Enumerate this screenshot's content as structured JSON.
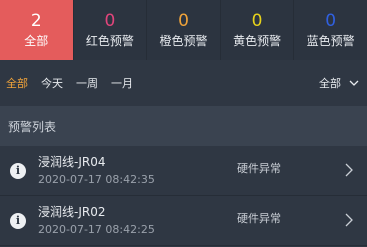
{
  "tabs": [
    {
      "count": "2",
      "label": "全部",
      "color": "#ffffff",
      "active": true
    },
    {
      "count": "0",
      "label": "红色预警",
      "color": "#e0457b",
      "active": false
    },
    {
      "count": "0",
      "label": "橙色预警",
      "color": "#f0a33a",
      "active": false
    },
    {
      "count": "0",
      "label": "黄色预警",
      "color": "#e7d21b",
      "active": false
    },
    {
      "count": "0",
      "label": "蓝色预警",
      "color": "#3060e0",
      "active": false
    }
  ],
  "filters": {
    "items": [
      "全部",
      "今天",
      "一周",
      "一月"
    ],
    "active_index": 0,
    "dropdown_label": "全部",
    "dropdown_icon": "chevron-down-icon"
  },
  "section": {
    "title": "预警列表"
  },
  "alerts": [
    {
      "name": "浸润线-JR04",
      "time": "2020-07-17 08:42:35",
      "status": "硬件异常",
      "icon": "info-icon"
    },
    {
      "name": "浸润线-JR02",
      "time": "2020-07-17 08:42:25",
      "status": "硬件异常",
      "icon": "info-icon"
    }
  ],
  "colors": {
    "accent_red": "#e45c5c",
    "filter_active": "#f0a33a",
    "background": "#2f3743"
  }
}
